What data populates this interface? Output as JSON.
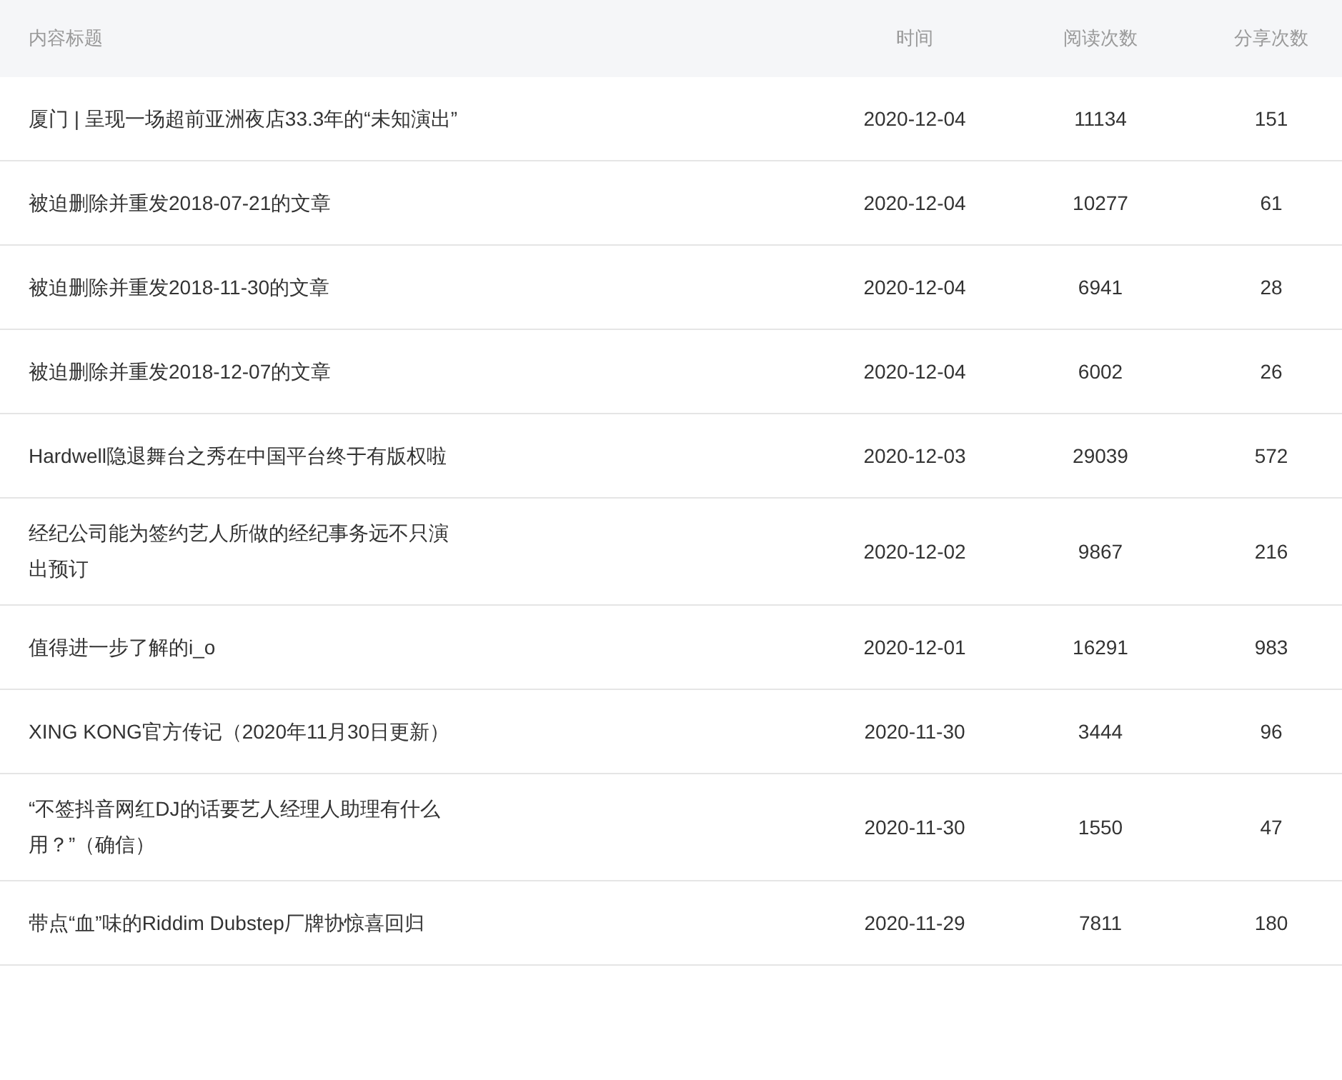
{
  "table": {
    "columns": [
      "内容标题",
      "时间",
      "阅读次数",
      "分享次数"
    ],
    "rows": [
      {
        "title": "厦门 | 呈现一场超前亚洲夜店33.3年的“未知演出”",
        "time": "2020-12-04",
        "reads": "11134",
        "shares": "151"
      },
      {
        "title": "被迫删除并重发2018-07-21的文章",
        "time": "2020-12-04",
        "reads": "10277",
        "shares": "61"
      },
      {
        "title": "被迫删除并重发2018-11-30的文章",
        "time": "2020-12-04",
        "reads": "6941",
        "shares": "28"
      },
      {
        "title": "被迫删除并重发2018-12-07的文章",
        "time": "2020-12-04",
        "reads": "6002",
        "shares": "26"
      },
      {
        "title": "Hardwell隐退舞台之秀在中国平台终于有版权啦",
        "time": "2020-12-03",
        "reads": "29039",
        "shares": "572"
      },
      {
        "title": "经纪公司能为签约艺人所做的经纪事务远不只演出预订",
        "time": "2020-12-02",
        "reads": "9867",
        "shares": "216"
      },
      {
        "title": "值得进一步了解的i_o",
        "time": "2020-12-01",
        "reads": "16291",
        "shares": "983"
      },
      {
        "title": "XING KONG官方传记（2020年11月30日更新）",
        "time": "2020-11-30",
        "reads": "3444",
        "shares": "96"
      },
      {
        "title": "“不签抖音网红DJ的话要艺人经理人助理有什么用？”（确信）",
        "time": "2020-11-30",
        "reads": "1550",
        "shares": "47"
      },
      {
        "title": "带点“血”味的Riddim Dubstep厂牌协惊喜回归",
        "time": "2020-11-29",
        "reads": "7811",
        "shares": "180"
      }
    ]
  }
}
